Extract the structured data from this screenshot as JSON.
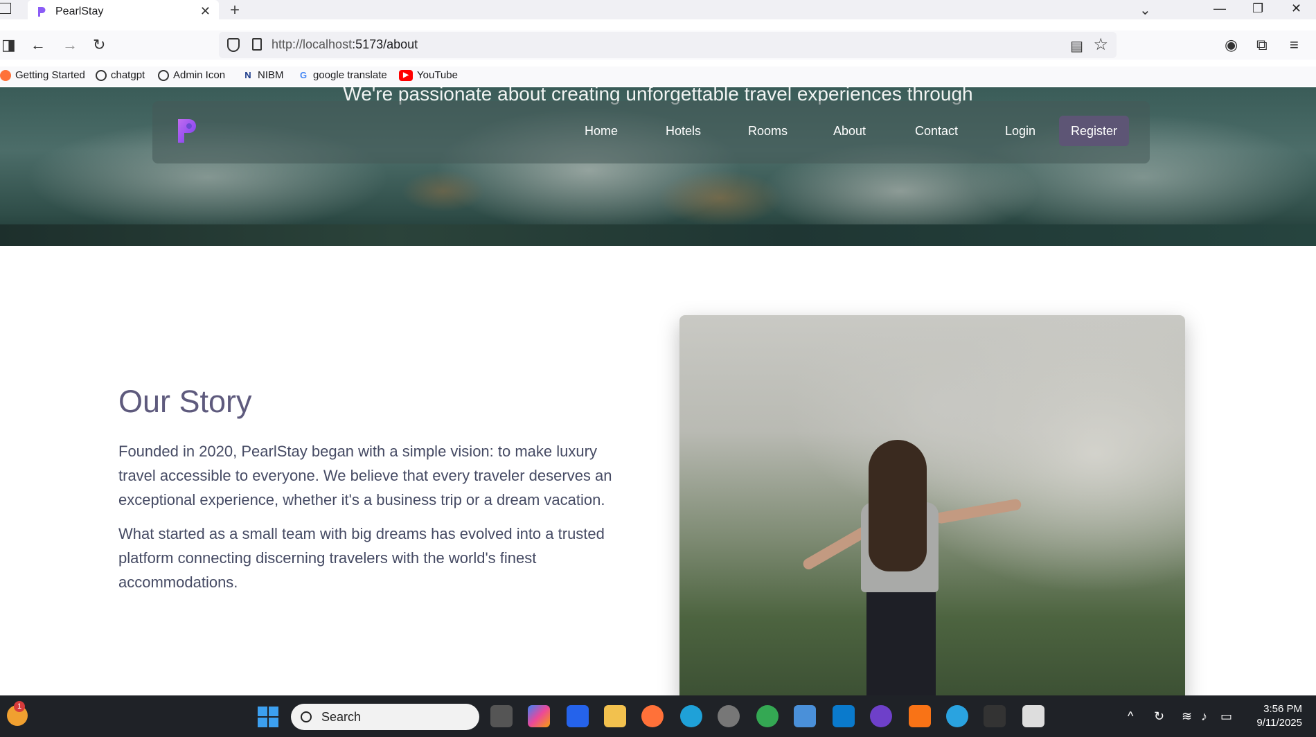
{
  "browser": {
    "tab_title": "PearlStay",
    "url_host": "http://localhost",
    "url_rest": ":5173/about",
    "bookmarks": [
      {
        "label": "Getting Started",
        "icon": "firefox-icon"
      },
      {
        "label": "chatgpt",
        "icon": "openai-icon"
      },
      {
        "label": "Admin Icon",
        "icon": "globe-icon"
      },
      {
        "label": "NIBM",
        "icon": "nibm-icon"
      },
      {
        "label": "google translate",
        "icon": "google-icon"
      },
      {
        "label": "YouTube",
        "icon": "youtube-icon"
      }
    ]
  },
  "hero": {
    "text": "We're passionate about creating unforgettable travel experiences through"
  },
  "site_nav": {
    "brand_icon": "pearlstay-logo-icon",
    "links": [
      "Home",
      "Hotels",
      "Rooms",
      "About",
      "Contact",
      "Login"
    ],
    "register": "Register"
  },
  "story": {
    "title": "Our Story",
    "paragraphs": [
      "Founded in 2020, PearlStay began with a simple vision: to make luxury travel accessible to everyone. We believe that every traveler deserves an exceptional experience, whether it's a business trip or a dream vacation.",
      "What started as a small team with big dreams has evolved into a trusted platform connecting discerning travelers with the world's finest accommodations."
    ]
  },
  "taskbar": {
    "search_label": "Search",
    "weather_badge": "1",
    "time": "3:56 PM",
    "date": "9/11/2025"
  },
  "colors": {
    "accent": "#5d5575",
    "title": "#5e5a7d",
    "body_text": "#454a63"
  }
}
